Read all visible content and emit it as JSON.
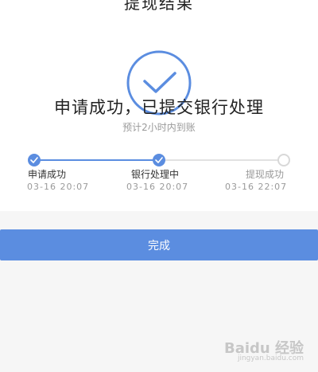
{
  "nav": {
    "title": "提现结果"
  },
  "status": {
    "headline": "申请成功，已提交银行处理",
    "subline": "预计2小时内到账"
  },
  "steps": [
    {
      "label": "申请成功",
      "time": "03-16 20:07",
      "done": true
    },
    {
      "label": "银行处理中",
      "time": "03-16 20:07",
      "done": true
    },
    {
      "label": "提现成功",
      "time": "03-16 22:07",
      "done": false
    }
  ],
  "actions": {
    "done_label": "完成"
  },
  "watermark": {
    "text": "Baidu 经验",
    "url": "jingyan.baidu.com"
  },
  "colors": {
    "accent": "#5b8de0",
    "pending": "#d8d8d8"
  },
  "icons": {
    "status": "check-circle-icon",
    "step": "check-icon"
  }
}
